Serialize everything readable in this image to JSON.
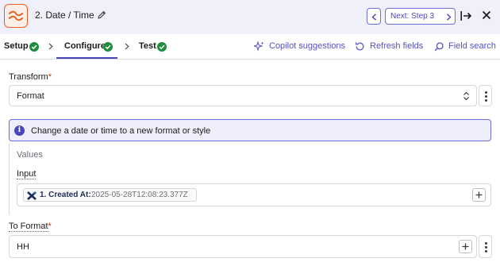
{
  "header": {
    "step_title": "2. Date / Time",
    "next_label": "Next: Step 3"
  },
  "tabs": [
    {
      "label": "Setup",
      "complete": true
    },
    {
      "label": "Configure",
      "complete": true,
      "active": true
    },
    {
      "label": "Test",
      "complete": true
    }
  ],
  "toolbar": {
    "copilot_label": "Copilot suggestions",
    "refresh_label": "Refresh fields",
    "search_label": "Field search"
  },
  "transform": {
    "label": "Transform",
    "required_mark": "*",
    "value": "Format"
  },
  "info": {
    "icon_text": "i",
    "text": "Change a date or time to a new format or style"
  },
  "values": {
    "heading": "Values",
    "input_label": "Input",
    "input_token_label": "1. Created At:",
    "input_token_value": "2025-05-28T12:08:23.377Z"
  },
  "to_format": {
    "label": "To Format",
    "required_mark": "*",
    "value": "HH"
  },
  "colors": {
    "accent": "#4a48b8",
    "success": "#1e8e3e",
    "brand_orange": "#e0642a",
    "required": "#d1341f"
  }
}
